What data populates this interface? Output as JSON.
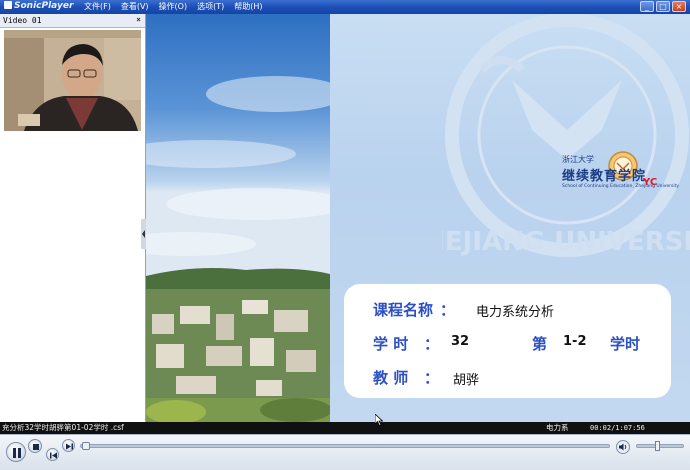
{
  "app": {
    "name": "SonicPlayer",
    "menu": [
      "文件(F)",
      "查看(V)",
      "操作(O)",
      "选项(T)",
      "帮助(H)"
    ]
  },
  "video_panel": {
    "title": "Video 01",
    "close_glyph": "×"
  },
  "slide": {
    "brand_top": "浙江大学",
    "brand_main": "继续教育学院",
    "brand_sub": "School of Continuing Education, Zhejiang University",
    "brand_tag": "YC",
    "watermark_text": "ZHEJIANG UNIVERSITY",
    "course_label": "课程名称",
    "course_colon": "：",
    "course_value": "电力系统分析",
    "hours_label": "学   时",
    "hours_colon": "：",
    "hours_value": "32",
    "session_label": "第",
    "session_value": "1-2",
    "session_unit": "学时",
    "teacher_label": "教   师",
    "teacher_colon": "：",
    "teacher_value": "胡骅"
  },
  "status": {
    "file_title": "充分析32学时胡骅第01-02学时 .csf",
    "clip_name": "电力系",
    "time": "00:02/1:07:56"
  },
  "player": {
    "progress": 0.001,
    "volume": 0.45
  },
  "icons": [
    "play-pause-icon",
    "stop-icon",
    "previous-icon",
    "next-icon",
    "volume-icon"
  ],
  "colors": {
    "title_bar": "#1d4fb6",
    "slide_label": "#2c50c4",
    "brand": "#1c3d86",
    "brand_tag": "#d81f26",
    "status_bar": "#101010"
  }
}
